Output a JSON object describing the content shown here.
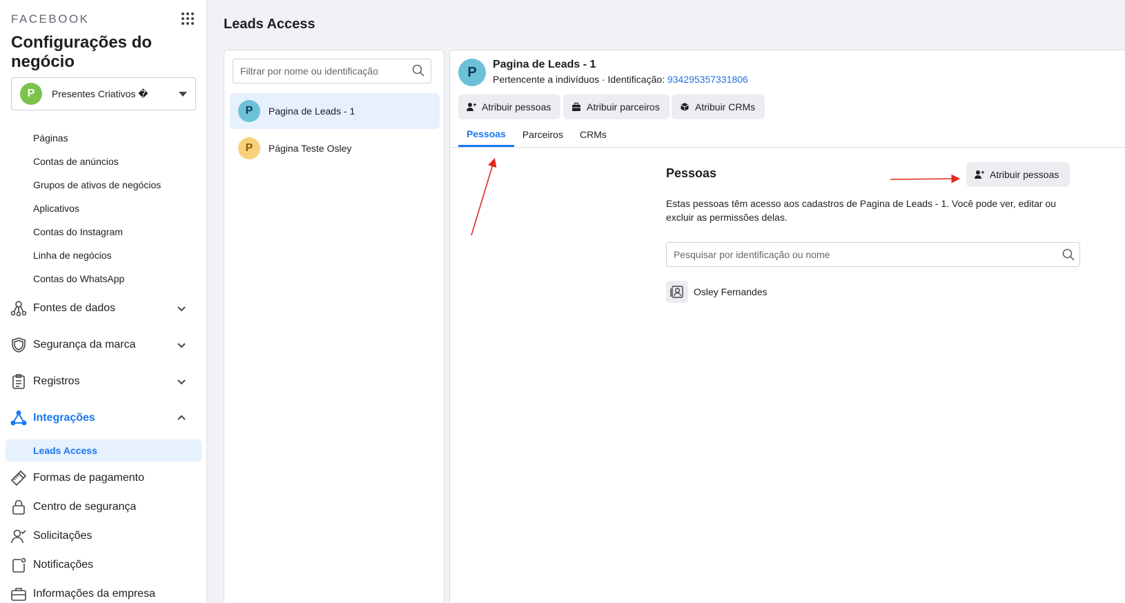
{
  "sidebar": {
    "brand": "FACEBOOK",
    "title": "Configurações do negócio",
    "business": {
      "initial": "P",
      "name": "Presentes Criativos �",
      "color": "#7cc34e"
    },
    "sub_items": [
      "Páginas",
      "Contas de anúncios",
      "Grupos de ativos de negócios",
      "Aplicativos",
      "Contas do Instagram",
      "Linha de negócios",
      "Contas do WhatsApp"
    ],
    "sections": [
      {
        "label": "Fontes de dados",
        "icon": "data-sources-icon"
      },
      {
        "label": "Segurança da marca",
        "icon": "shield-icon"
      },
      {
        "label": "Registros",
        "icon": "clipboard-icon"
      },
      {
        "label": "Integrações",
        "icon": "integrations-icon",
        "expanded": true
      }
    ],
    "active_sub_item": "Leads Access",
    "bottom_items": [
      {
        "label": "Formas de pagamento",
        "icon": "credit-card-icon"
      },
      {
        "label": "Centro de segurança",
        "icon": "lock-icon"
      },
      {
        "label": "Solicitações",
        "icon": "user-check-icon"
      },
      {
        "label": "Notificações",
        "icon": "notification-icon"
      },
      {
        "label": "Informações da empresa",
        "icon": "briefcase-icon"
      }
    ]
  },
  "header": {
    "title": "Leads Access"
  },
  "list": {
    "filter_placeholder": "Filtrar por nome ou identificação",
    "items": [
      {
        "initial": "P",
        "label": "Pagina de Leads - 1",
        "avatar_color": "#6cc0d8",
        "selected": true
      },
      {
        "initial": "P",
        "label": "Página Teste Osley",
        "avatar_color": "#f7d27a",
        "selected": false
      }
    ]
  },
  "detail": {
    "initial": "P",
    "name": "Pagina de Leads - 1",
    "meta_prefix": "Pertencente a indivíduos · Identificação: ",
    "id": "934295357331806",
    "actions": [
      "Atribuir pessoas",
      "Atribuir parceiros",
      "Atribuir CRMs"
    ],
    "tabs": [
      "Pessoas",
      "Parceiros",
      "CRMs"
    ],
    "active_tab": "Pessoas",
    "section": {
      "title": "Pessoas",
      "assign_label": "Atribuir pessoas",
      "description": "Estas pessoas têm acesso aos cadastros de Pagina de Leads - 1. Você pode ver, editar ou excluir as permissões delas.",
      "search_placeholder": "Pesquisar por identificação ou nome",
      "people": [
        {
          "name": "Osley Fernandes"
        }
      ]
    }
  },
  "colors": {
    "accent": "#1877f2",
    "annotation_arrow": "#e0291f"
  }
}
